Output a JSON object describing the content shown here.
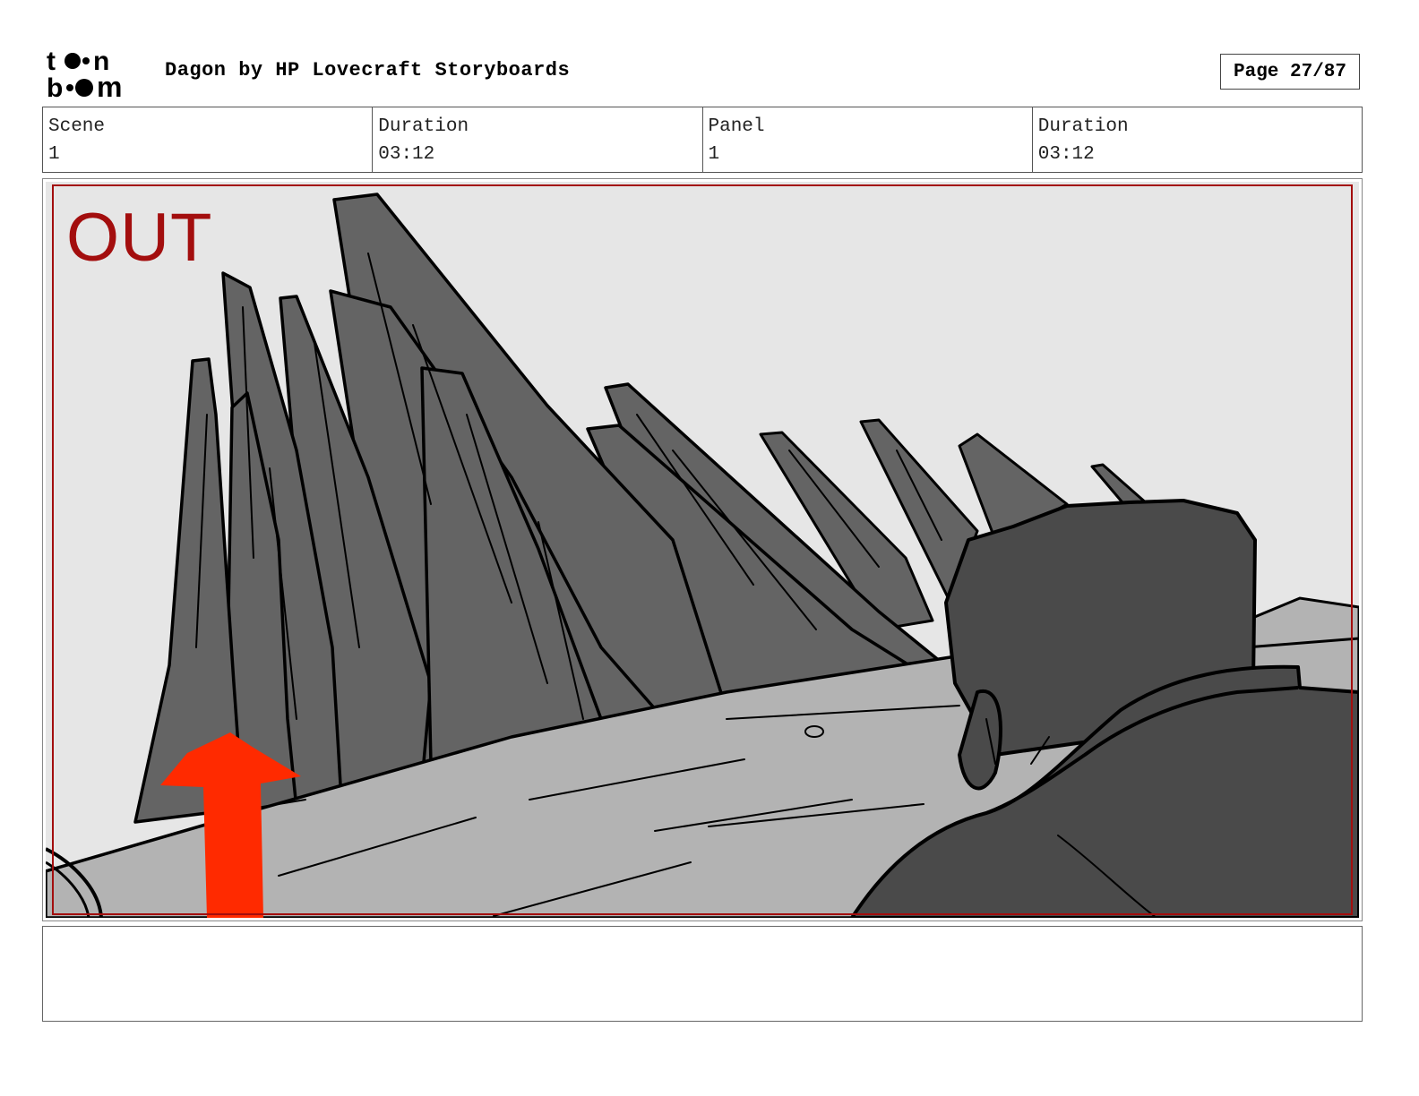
{
  "header": {
    "logo_text": "toon boom",
    "title": "Dagon by HP Lovecraft Storyboards",
    "page_label": "Page 27/87"
  },
  "info": [
    {
      "label": "Scene",
      "value": "1"
    },
    {
      "label": "Duration",
      "value": "03:12"
    },
    {
      "label": "Panel",
      "value": "1"
    },
    {
      "label": "Duration",
      "value": "03:12"
    }
  ],
  "panel": {
    "overlay_text": "OUT",
    "overlay_color": "#a30e0e",
    "arrow_color": "#ff2a00",
    "arrow_direction": "up",
    "sky_color": "#e6e6e6",
    "ground_color": "#b3b3b3",
    "rock_color": "#646464",
    "figure_color": "#4a4a4a"
  },
  "notes": {
    "text": ""
  }
}
